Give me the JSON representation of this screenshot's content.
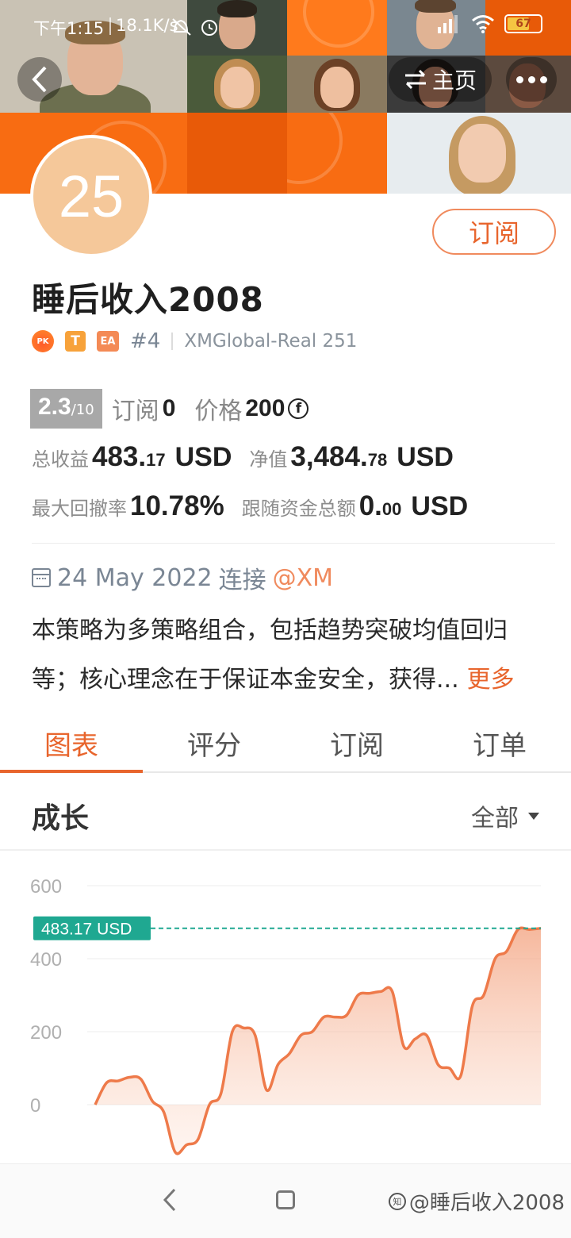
{
  "status_bar": {
    "time": "下午1:15",
    "speed": "18.1K/s",
    "battery": "67"
  },
  "header": {
    "home_label": "主页",
    "swap_icon": "swap-icon",
    "back_icon": "back-arrow-icon",
    "more_icon": "more-dots-icon"
  },
  "profile": {
    "avatar_number": "25",
    "subscribe_label": "订阅",
    "name": "睡后收入2008",
    "badges": [
      "PK",
      "T",
      "EA"
    ],
    "rank": "#4",
    "account": "XMGlobal-Real 251"
  },
  "stats": {
    "score": "2.3",
    "score_max": "/10",
    "subscribe_label": "订阅",
    "subscribe_count": "0",
    "price_label": "价格",
    "price_value": "200",
    "coin_symbol": "f",
    "total_profit_label": "总收益",
    "total_profit_int": "483.",
    "total_profit_dec": "17",
    "total_profit_unit": "USD",
    "equity_label": "净值",
    "equity_int": "3,484.",
    "equity_dec": "78",
    "equity_unit": "USD",
    "drawdown_label": "最大回撤率",
    "drawdown_value": "10.78%",
    "follow_label": "跟随资金总额",
    "follow_int": "0.",
    "follow_dec": "00",
    "follow_unit": "USD"
  },
  "connection": {
    "date": "24 May 2022",
    "connect_label": "连接",
    "broker_link": "@XM"
  },
  "description": {
    "line1": "本策略为多策略组合，包括趋势突破均值回归",
    "line2": "等；核心理念在于保证本金安全，获得...",
    "more_label": "更多"
  },
  "tabs": [
    {
      "label": "图表",
      "active": true
    },
    {
      "label": "评分",
      "active": false
    },
    {
      "label": "订阅",
      "active": false
    },
    {
      "label": "订单",
      "active": false
    }
  ],
  "growth": {
    "title": "成长",
    "filter_label": "全部"
  },
  "chart_data": {
    "type": "area",
    "ylim": [
      -150,
      600
    ],
    "yticks": [
      0,
      200,
      400,
      600
    ],
    "ytick_labels": [
      "0",
      "200",
      "400",
      "600"
    ],
    "current_value": 483.17,
    "current_label": "483.17 USD",
    "line_color": "#ee7a4a",
    "marker_color": "#1fa891",
    "values": [
      0,
      60,
      65,
      75,
      70,
      10,
      -20,
      -130,
      -110,
      -95,
      0,
      30,
      200,
      210,
      190,
      40,
      110,
      140,
      190,
      200,
      240,
      240,
      245,
      300,
      305,
      310,
      310,
      160,
      180,
      190,
      110,
      100,
      80,
      270,
      300,
      400,
      420,
      480,
      480,
      483.17
    ]
  },
  "navbar": {
    "watermark": "@睡后收入2008",
    "watermark_logo": "知"
  }
}
